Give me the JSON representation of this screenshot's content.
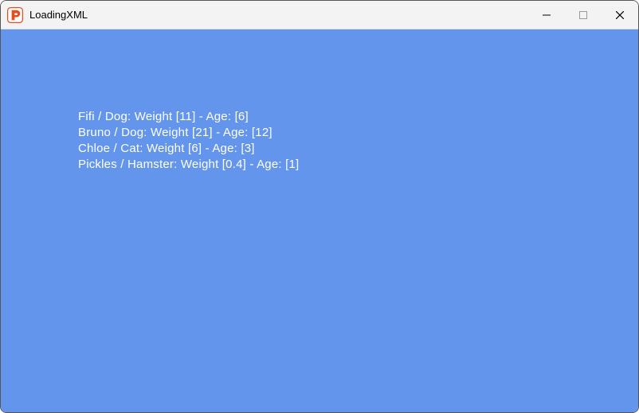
{
  "window": {
    "title": "LoadingXML",
    "controls": {
      "minimize_enabled": true,
      "maximize_enabled": false,
      "close_enabled": true
    }
  },
  "colors": {
    "client_bg": "#6495ED",
    "text": "#FFFFFF",
    "titlebar_bg": "#F3F3F3",
    "icon_accent": "#E84E1B"
  },
  "pets": [
    {
      "name": "Fifi",
      "species": "Dog",
      "weight": "11",
      "age": "6"
    },
    {
      "name": "Bruno",
      "species": "Dog",
      "weight": "21",
      "age": "12"
    },
    {
      "name": "Chloe",
      "species": "Cat",
      "weight": "6",
      "age": "3"
    },
    {
      "name": "Pickles",
      "species": "Hamster",
      "weight": "0.4",
      "age": "1"
    }
  ],
  "line_template": "{name} / {species}: Weight [{weight}] - Age: [{age}]"
}
